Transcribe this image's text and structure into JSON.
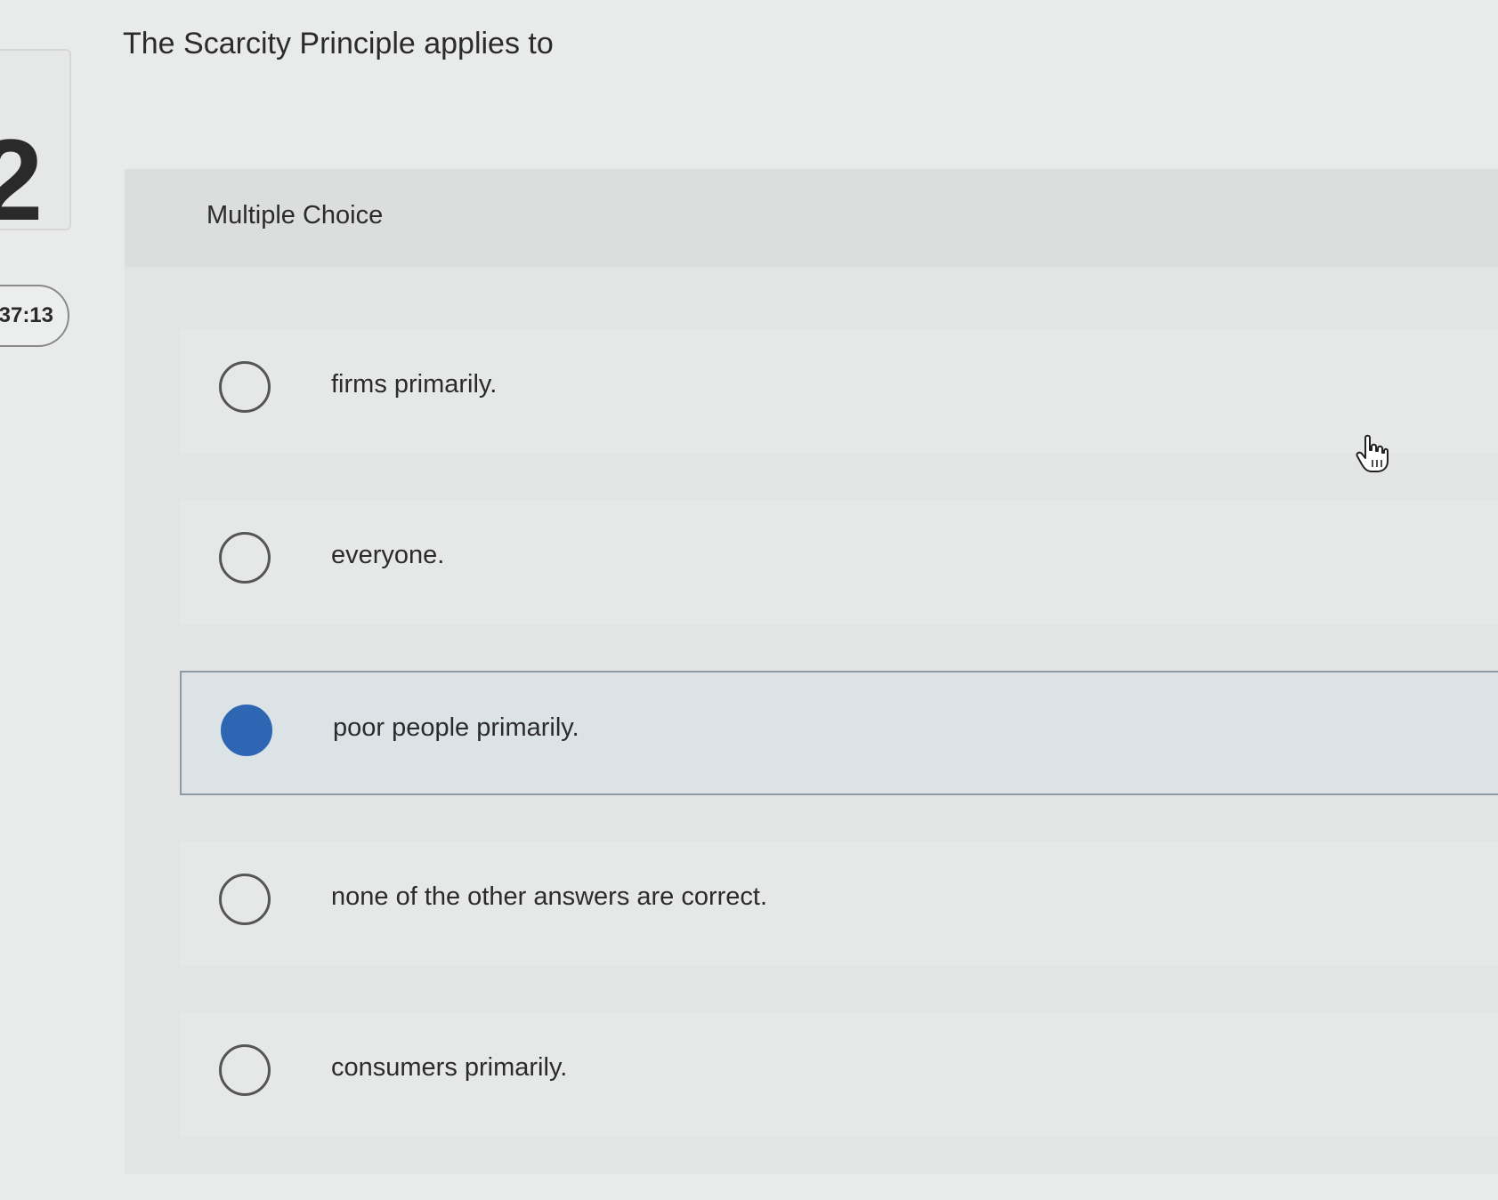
{
  "sidebar": {
    "question_number": "2",
    "timer": ":37:13"
  },
  "question": {
    "prompt": "The Scarcity Principle applies to",
    "type_label": "Multiple Choice",
    "options": [
      {
        "label": "firms primarily.",
        "selected": false
      },
      {
        "label": "everyone.",
        "selected": false
      },
      {
        "label": "poor people primarily.",
        "selected": true
      },
      {
        "label": "none of the other answers are correct.",
        "selected": false
      },
      {
        "label": "consumers primarily.",
        "selected": false
      }
    ]
  },
  "colors": {
    "selected_radio": "#2f66b3",
    "selected_background": "#dbe3e6"
  },
  "icons": {
    "cursor": "hand-pointer-icon"
  }
}
